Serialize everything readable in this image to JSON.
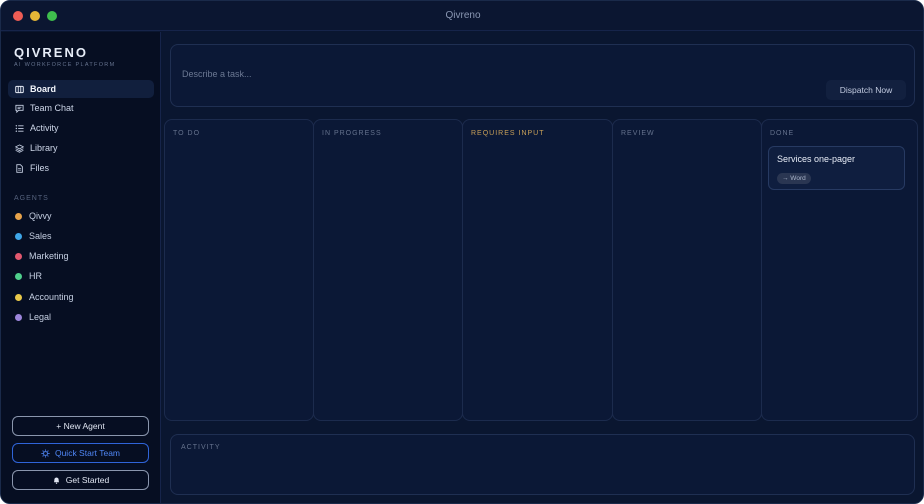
{
  "window": {
    "title": "Qivreno"
  },
  "brand": {
    "name": "QIVRENO",
    "tagline": "AI WORKFORCE PLATFORM"
  },
  "nav": [
    {
      "label": "Board",
      "icon": "board-icon",
      "active": true
    },
    {
      "label": "Team Chat",
      "icon": "chat-icon",
      "active": false
    },
    {
      "label": "Activity",
      "icon": "list-icon",
      "active": false
    },
    {
      "label": "Library",
      "icon": "layers-icon",
      "active": false
    },
    {
      "label": "Files",
      "icon": "file-icon",
      "active": false
    }
  ],
  "agents": {
    "header": "AGENTS",
    "items": [
      {
        "label": "Qivvy",
        "color": "#e7a34b"
      },
      {
        "label": "Sales",
        "color": "#3ea6e8"
      },
      {
        "label": "Marketing",
        "color": "#e2586f"
      },
      {
        "label": "HR",
        "color": "#4fcf8c"
      },
      {
        "label": "Accounting",
        "color": "#e8c84a"
      },
      {
        "label": "Legal",
        "color": "#9c86db"
      }
    ]
  },
  "buttons": {
    "new_agent": "+ New Agent",
    "quick_start": "Quick Start Team",
    "get_started": "Get Started"
  },
  "task": {
    "placeholder": "Describe a task...",
    "dispatch_label": "Dispatch Now"
  },
  "columns": [
    {
      "title": "TO DO",
      "cards": []
    },
    {
      "title": "IN PROGRESS",
      "cards": []
    },
    {
      "title": "REQUIRES INPUT",
      "cards": []
    },
    {
      "title": "REVIEW",
      "cards": []
    },
    {
      "title": "DONE",
      "cards": [
        {
          "title": "Services one-pager",
          "tag": "→ Word"
        }
      ]
    }
  ],
  "activity": {
    "title": "ACTIVITY"
  },
  "colors": {
    "accent": "#2f64d9",
    "requires_input": "#c9a058",
    "background": "#0a1630"
  }
}
